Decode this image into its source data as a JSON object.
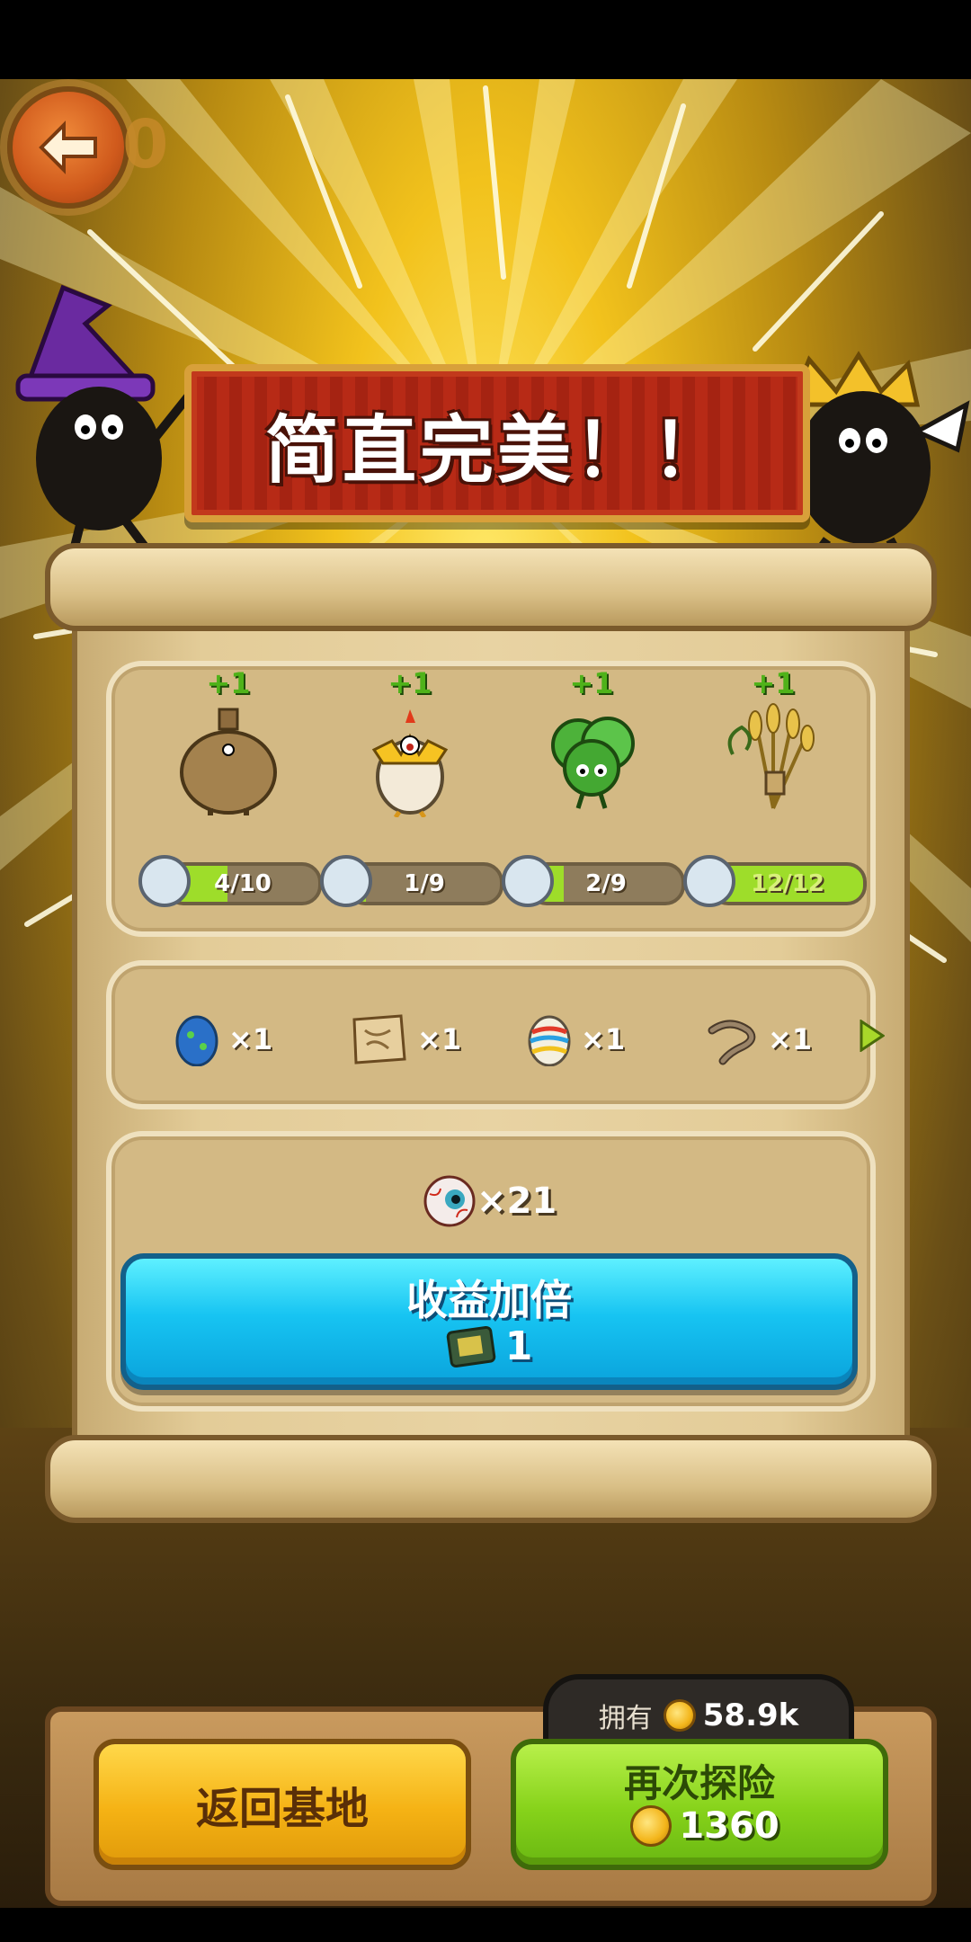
{
  "top_bar": {
    "back_icon": "arrow-left-icon",
    "counter": "0"
  },
  "banner": {
    "title": "简直完美！！"
  },
  "monsters": [
    {
      "name_icon": "sack-monster",
      "bonus": "+1",
      "progress_text": "4/10",
      "progress": 0.4
    },
    {
      "name_icon": "chick-egg-monster",
      "bonus": "+1",
      "progress_text": "1/9",
      "progress": 0.111
    },
    {
      "name_icon": "lettuce-monster",
      "bonus": "+1",
      "progress_text": "2/9",
      "progress": 0.222
    },
    {
      "name_icon": "wheat-monster",
      "bonus": "+1",
      "progress_text": "12/12",
      "progress": 1.0
    }
  ],
  "items": [
    {
      "icon": "blue-egg-icon",
      "qty": "×1"
    },
    {
      "icon": "map-scroll-icon",
      "qty": "×1"
    },
    {
      "icon": "rainbow-egg-icon",
      "qty": "×1"
    },
    {
      "icon": "worm-icon",
      "qty": "×1"
    }
  ],
  "reward": {
    "icon": "eyeball-icon",
    "count": "×21"
  },
  "double_button": {
    "label": "收益加倍",
    "cost_icon": "ticket-icon",
    "cost": "1"
  },
  "owned": {
    "label": "拥有",
    "value": "58.9k"
  },
  "home_button": {
    "label": "返回基地"
  },
  "again_button": {
    "label": "再次探险",
    "cost": "1360"
  },
  "colors": {
    "accent_blue": "#17c4f2",
    "accent_green": "#86d21a",
    "accent_yellow": "#f5b214",
    "banner_red": "#b72a16"
  }
}
